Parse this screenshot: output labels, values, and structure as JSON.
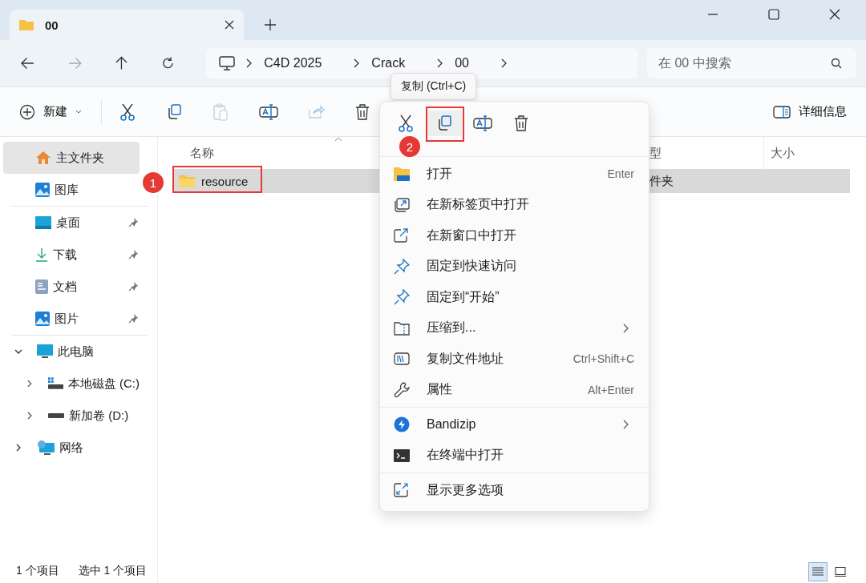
{
  "tab": {
    "title": "00",
    "selected": true
  },
  "breadcrumb": [
    "C4D 2025",
    "Crack",
    "00"
  ],
  "search": {
    "placeholder": "在 00 中搜索"
  },
  "toolbar": {
    "new_label": "新建",
    "details_label": "详细信息"
  },
  "tooltip": "复制 (Ctrl+C)",
  "sidebar": {
    "groups": [
      [
        {
          "label": "主文件夹",
          "kind": "home",
          "selected": true,
          "pinned": false
        },
        {
          "label": "图库",
          "kind": "gallery",
          "selected": false,
          "pinned": false
        }
      ],
      [
        {
          "label": "桌面",
          "kind": "desktop",
          "selected": false,
          "pinned": true
        },
        {
          "label": "下载",
          "kind": "download",
          "selected": false,
          "pinned": true
        },
        {
          "label": "文档",
          "kind": "documents",
          "selected": false,
          "pinned": true
        },
        {
          "label": "图片",
          "kind": "pictures",
          "selected": false,
          "pinned": true
        }
      ]
    ],
    "tree": [
      {
        "label": "此电脑",
        "kind": "pc",
        "expanded": true,
        "selected": false,
        "children": [
          {
            "label": "本地磁盘 (C:)",
            "kind": "system-drive",
            "expanded": false,
            "selected": false
          },
          {
            "label": "新加卷 (D:)",
            "kind": "drive",
            "expanded": false,
            "selected": false
          }
        ]
      },
      {
        "label": "网络",
        "kind": "network",
        "expanded": false,
        "selected": false
      }
    ]
  },
  "table": {
    "columns": [
      "名称",
      "型",
      "大小"
    ],
    "rows": [
      {
        "name": "resource",
        "column_2": "件夹",
        "selected": true
      }
    ]
  },
  "context_menu": {
    "actions": [
      {
        "kind": "cut",
        "highlighted": false
      },
      {
        "kind": "copy",
        "highlighted": true
      },
      {
        "kind": "rename",
        "highlighted": false
      },
      {
        "kind": "delete",
        "highlighted": false
      }
    ],
    "groups": [
      [
        {
          "kind": "folder",
          "label": "打开",
          "shortcut": "Enter",
          "submenu": false
        },
        {
          "kind": "new-tab",
          "label": "在新标签页中打开",
          "submenu": false
        },
        {
          "kind": "new-window",
          "label": "在新窗口中打开",
          "submenu": false
        },
        {
          "kind": "pin",
          "label": "固定到快速访问",
          "submenu": false
        },
        {
          "kind": "pin",
          "label": "固定到“开始”",
          "submenu": false
        },
        {
          "kind": "zip",
          "label": "压缩到...",
          "submenu": true
        },
        {
          "kind": "path",
          "label": "复制文件地址",
          "shortcut": "Ctrl+Shift+C",
          "submenu": false
        },
        {
          "kind": "wrench",
          "label": "属性",
          "shortcut": "Alt+Enter",
          "submenu": false
        }
      ],
      [
        {
          "kind": "bandizip",
          "label": "Bandizip",
          "submenu": true
        },
        {
          "kind": "terminal",
          "label": "在终端中打开",
          "submenu": false
        }
      ],
      [
        {
          "kind": "more",
          "label": "显示更多选项",
          "submenu": false
        }
      ]
    ]
  },
  "markers": [
    "1",
    "2"
  ],
  "status_bar": {
    "count": "1 个项目",
    "selection": "选中 1 个项目"
  },
  "view_buttons": [
    {
      "kind": "details",
      "selected": true
    },
    {
      "kind": "tiles",
      "selected": false
    }
  ]
}
